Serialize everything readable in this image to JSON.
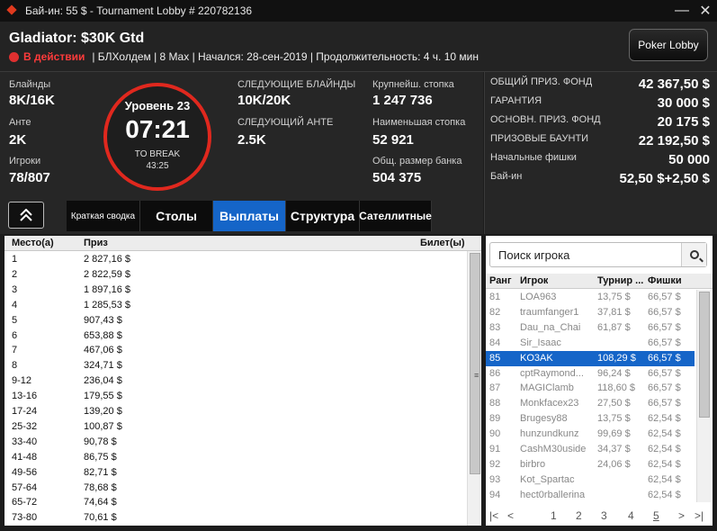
{
  "window": {
    "title": "Бай-ин: 55 $ - Tournament Lobby # 220782136",
    "minimize_glyph": "—",
    "close_glyph": "✕"
  },
  "header": {
    "tournament_name": "Gladiator: $30K Gtd",
    "status": "В действии",
    "details": "| БЛХолдем | 8 Max | Начался: 28-сен-2019 | Продолжительность: 4 ч. 10 мин",
    "poker_lobby_button": "Poker Lobby",
    "status_color": "#e03030"
  },
  "info": {
    "blinds_label": "Блайнды",
    "blinds_value": "8K/16K",
    "ante_label": "Анте",
    "ante_value": "2K",
    "players_label": "Игроки",
    "players_value": "78/807",
    "level": "Уровень 23",
    "clock": "07:21",
    "to_break_label": "TO BREAK",
    "to_break_time": "43:25",
    "next_blinds_label": "СЛЕДУЮЩИЕ БЛАЙНДЫ",
    "next_blinds_value": "10K/20K",
    "next_ante_label": "СЛЕДУЮЩИЙ АНТЕ",
    "next_ante_value": "2.5K",
    "largest_stack_label": "Крупнейш. стопка",
    "largest_stack_value": "1 247 736",
    "smallest_stack_label": "Наименьшая стопка",
    "smallest_stack_value": "52 921",
    "total_pot_label": "Общ. размер банка",
    "total_pot_value": "504 375"
  },
  "prize": {
    "rows": [
      {
        "label": "ОБЩИЙ ПРИЗ. ФОНД",
        "value": "42 367,50 $"
      },
      {
        "label": "ГАРАНТИЯ",
        "value": "30 000 $"
      },
      {
        "label": "ОСНОВН. ПРИЗ. ФОНД",
        "value": "20 175 $"
      },
      {
        "label": "ПРИЗОВЫЕ БАУНТИ",
        "value": "22 192,50 $"
      },
      {
        "label": "Начальные фишки",
        "value": "50 000"
      },
      {
        "label": "Бай-ин",
        "value": "52,50 $+2,50 $"
      }
    ]
  },
  "tabs": [
    {
      "label": "Краткая сводка"
    },
    {
      "label": "Столы"
    },
    {
      "label": "Выплаты"
    },
    {
      "label": "Структура"
    },
    {
      "label": "Сателлитные"
    }
  ],
  "payouts": {
    "headers": {
      "place": "Место(а)",
      "prize": "Приз",
      "ticket": "Билет(ы)"
    },
    "rows": [
      {
        "place": "1",
        "prize": "2 827,16 $"
      },
      {
        "place": "2",
        "prize": "2 822,59 $"
      },
      {
        "place": "3",
        "prize": "1 897,16 $"
      },
      {
        "place": "4",
        "prize": "1 285,53 $"
      },
      {
        "place": "5",
        "prize": "907,43 $"
      },
      {
        "place": "6",
        "prize": "653,88 $"
      },
      {
        "place": "7",
        "prize": "467,06 $"
      },
      {
        "place": "8",
        "prize": "324,71 $"
      },
      {
        "place": "9-12",
        "prize": "236,04 $"
      },
      {
        "place": "13-16",
        "prize": "179,55 $"
      },
      {
        "place": "17-24",
        "prize": "139,20 $"
      },
      {
        "place": "25-32",
        "prize": "100,87 $"
      },
      {
        "place": "33-40",
        "prize": "90,78 $"
      },
      {
        "place": "41-48",
        "prize": "86,75 $"
      },
      {
        "place": "49-56",
        "prize": "82,71 $"
      },
      {
        "place": "57-64",
        "prize": "78,68 $"
      },
      {
        "place": "65-72",
        "prize": "74,64 $"
      },
      {
        "place": "73-80",
        "prize": "70,61 $"
      }
    ]
  },
  "players": {
    "search_placeholder": "Поиск игрока",
    "headers": {
      "rank": "Ранг",
      "player": "Игрок",
      "tournament": "Турнир ...",
      "chips": "Фишки"
    },
    "selected_index": 4,
    "rows": [
      {
        "rank": "81",
        "player": "LOA963",
        "tournament": "13,75 $",
        "chips": "66,57 $"
      },
      {
        "rank": "82",
        "player": "traumfanger1",
        "tournament": "37,81 $",
        "chips": "66,57 $"
      },
      {
        "rank": "83",
        "player": "Dau_na_Chai",
        "tournament": "61,87 $",
        "chips": "66,57 $"
      },
      {
        "rank": "84",
        "player": "Sir_Isaac",
        "tournament": "",
        "chips": "66,57 $"
      },
      {
        "rank": "85",
        "player": "KO3AK",
        "tournament": "108,29 $",
        "chips": "66,57 $"
      },
      {
        "rank": "86",
        "player": "cptRaymond...",
        "tournament": "96,24 $",
        "chips": "66,57 $"
      },
      {
        "rank": "87",
        "player": "MAGIClamb",
        "tournament": "118,60 $",
        "chips": "66,57 $"
      },
      {
        "rank": "88",
        "player": "Monkfacex23",
        "tournament": "27,50 $",
        "chips": "66,57 $"
      },
      {
        "rank": "89",
        "player": "Brugesy88",
        "tournament": "13,75 $",
        "chips": "62,54 $"
      },
      {
        "rank": "90",
        "player": "hunzundkunz",
        "tournament": "99,69 $",
        "chips": "62,54 $"
      },
      {
        "rank": "91",
        "player": "CashM30uside",
        "tournament": "34,37 $",
        "chips": "62,54 $"
      },
      {
        "rank": "92",
        "player": "birbro",
        "tournament": "24,06 $",
        "chips": "62,54 $"
      },
      {
        "rank": "93",
        "player": "Kot_Spartac",
        "tournament": "",
        "chips": "62,54 $"
      },
      {
        "rank": "94",
        "player": "hect0rballerina",
        "tournament": "",
        "chips": "62,54 $"
      }
    ],
    "pages": [
      "1",
      "2",
      "3",
      "4",
      "5"
    ],
    "current_page": "5"
  }
}
